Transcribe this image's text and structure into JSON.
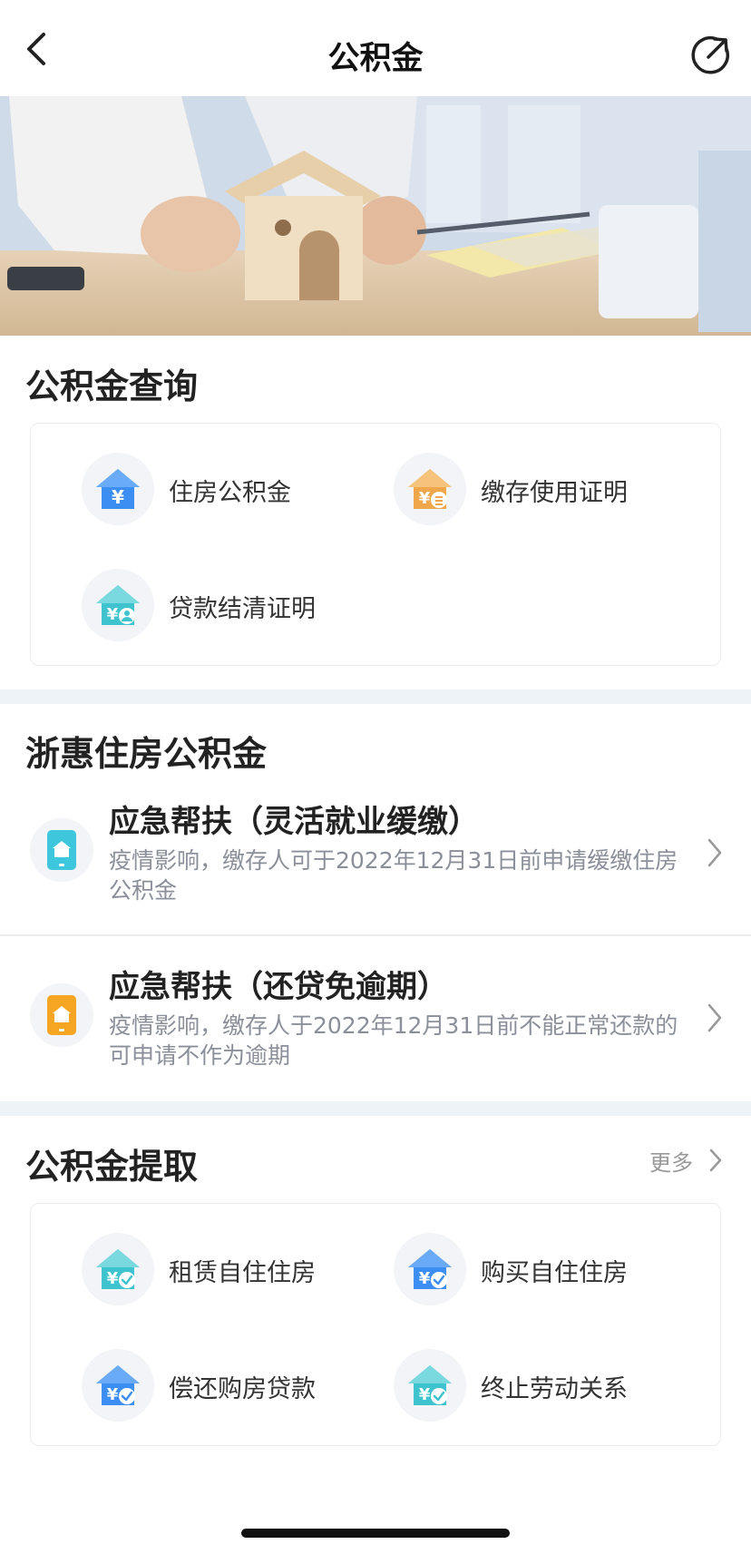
{
  "header": {
    "title": "公积金"
  },
  "query_section": {
    "title": "公积金查询",
    "items": [
      {
        "label": "住房公积金",
        "icon": "house-yuan-icon",
        "color": "#3d8ef2"
      },
      {
        "label": "缴存使用证明",
        "icon": "house-yuan-doc-icon",
        "color": "#f0a64a"
      },
      {
        "label": "贷款结清证明",
        "icon": "house-yuan-person-icon",
        "color": "#3fc3cf"
      }
    ]
  },
  "zhehui_section": {
    "title": "浙惠住房公积金",
    "items": [
      {
        "title": "应急帮扶（灵活就业缓缴）",
        "desc": "疫情影响，缴存人可于2022年12月31日前申请缓缴住房公积金",
        "icon": "phone-house-icon",
        "color": "#3ec6dc"
      },
      {
        "title": "应急帮扶（还贷免逾期）",
        "desc": "疫情影响，缴存人于2022年12月31日前不能正常还款的可申请不作为逾期",
        "icon": "phone-house-icon",
        "color": "#f6a623"
      }
    ]
  },
  "withdraw_section": {
    "title": "公积金提取",
    "more_label": "更多",
    "items": [
      {
        "label": "租赁自住住房",
        "icon": "house-yuan-check-icon",
        "color": "#3fc3cf"
      },
      {
        "label": "购买自住住房",
        "icon": "house-yuan-check-icon",
        "color": "#3d8ef2"
      },
      {
        "label": "偿还购房贷款",
        "icon": "house-yuan-check-icon",
        "color": "#3d8ef2"
      },
      {
        "label": "终止劳动关系",
        "icon": "house-yuan-check-icon",
        "color": "#3fc3cf"
      }
    ]
  }
}
